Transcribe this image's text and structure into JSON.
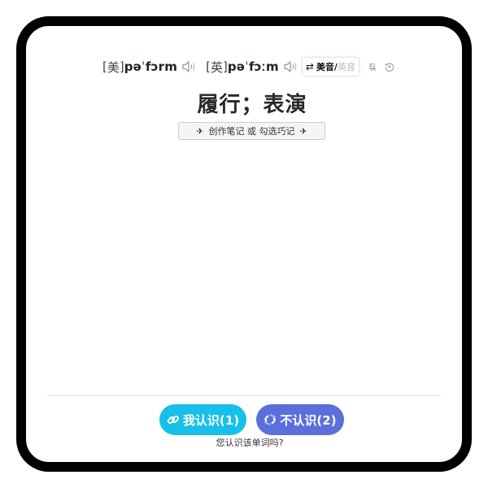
{
  "phonetics": {
    "us": {
      "region": "美",
      "ipa_before": "pə",
      "ipa_mark": "ˈ",
      "ipa_after": "fɔrm",
      "speaker_icon": "speaker-icon"
    },
    "uk": {
      "region": "英",
      "ipa_before": "pə",
      "ipa_mark": "ˈ",
      "ipa_after": "fɔːm",
      "speaker_icon": "speaker-icon"
    },
    "accent_toggle": {
      "arrow": "⇄",
      "active": "美音",
      "separator": "/",
      "inactive": "英音"
    },
    "icons": [
      "bell-off-icon",
      "replay-icon"
    ]
  },
  "word": {
    "meaning": "履行；表演"
  },
  "note_button": {
    "label": "创作笔记 或 勾选巧记",
    "icon_left": "✈",
    "icon_right": "✈"
  },
  "answer": {
    "know_label": "我认识(1)",
    "unknown_label": "不认识(2)",
    "question": "您认识该单词吗?"
  },
  "colors": {
    "know": "#17c0e8",
    "unknown": "#5b6fdc",
    "accent_red": "#c0392b"
  }
}
